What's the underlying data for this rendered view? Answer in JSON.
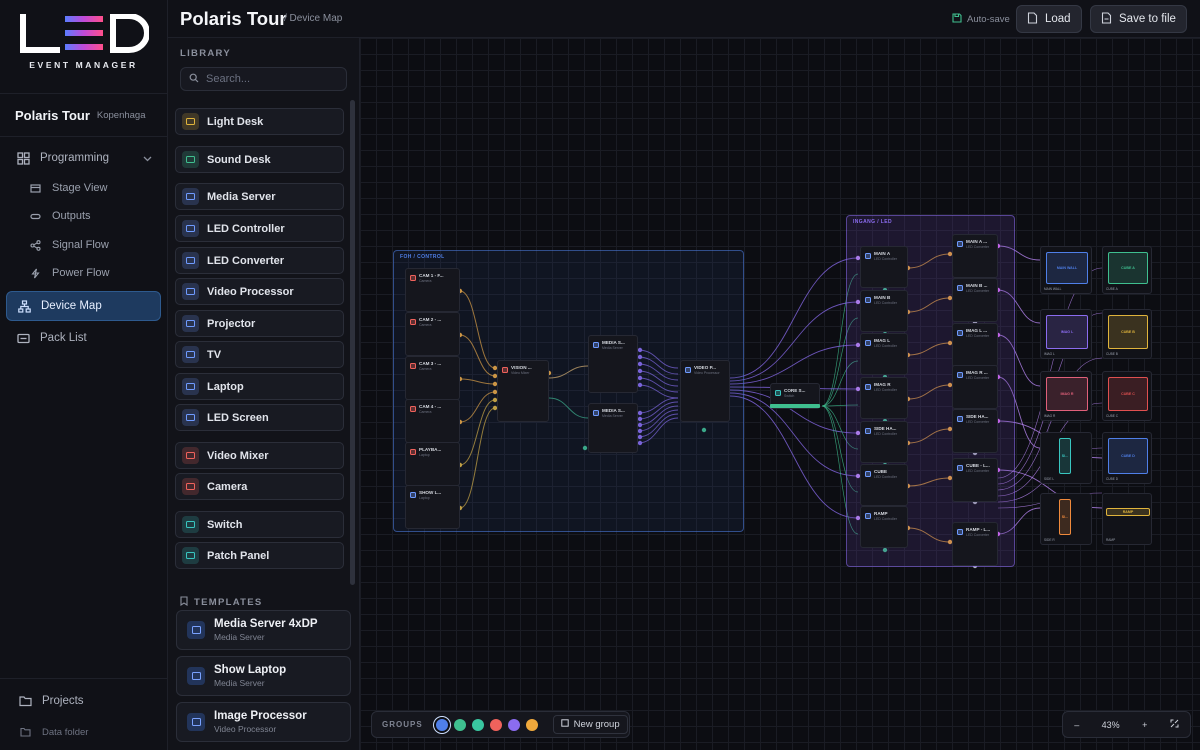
{
  "brand": {
    "logo_text": "LED",
    "subtitle": "EVENT MANAGER"
  },
  "project": {
    "name": "Polaris Tour",
    "location": "Kopenhaga"
  },
  "nav": {
    "programming": "Programming",
    "stage_view": "Stage View",
    "outputs": "Outputs",
    "signal_flow": "Signal Flow",
    "power_flow": "Power Flow",
    "device_map": "Device Map",
    "pack_list": "Pack List",
    "projects": "Projects",
    "data_folder": "Data folder"
  },
  "header": {
    "title": "Polaris Tour",
    "breadcrumb": "/ Device Map",
    "autosave": "Auto-save",
    "load": "Load",
    "save": "Save to file"
  },
  "library": {
    "label": "LIBRARY",
    "search_placeholder": "Search...",
    "items": [
      {
        "label": "Light Desk",
        "color": "#e0b43c"
      },
      {
        "label": "Sound Desk",
        "color": "#3fbf8f"
      },
      {
        "label": "Media Server",
        "color": "#6f9bff"
      },
      {
        "label": "LED Controller",
        "color": "#6f9bff"
      },
      {
        "label": "LED Converter",
        "color": "#6f9bff"
      },
      {
        "label": "Video Processor",
        "color": "#6f9bff"
      },
      {
        "label": "Projector",
        "color": "#6f9bff"
      },
      {
        "label": "TV",
        "color": "#6f9bff"
      },
      {
        "label": "Laptop",
        "color": "#6f9bff"
      },
      {
        "label": "LED Screen",
        "color": "#6f9bff"
      },
      {
        "label": "Video Mixer",
        "color": "#f0625c"
      },
      {
        "label": "Camera",
        "color": "#f0625c"
      },
      {
        "label": "Switch",
        "color": "#39c6c0"
      },
      {
        "label": "Patch Panel",
        "color": "#39c6c0"
      }
    ]
  },
  "templates": {
    "label": "TEMPLATES",
    "items": [
      {
        "name": "Media Server 4xDP",
        "type": "Media Server"
      },
      {
        "name": "Show Laptop",
        "type": "Media Server"
      },
      {
        "name": "Image Processor",
        "type": "Video Processor"
      }
    ]
  },
  "canvas": {
    "groups": [
      {
        "label": "FOH / CONTROL",
        "color": "#4f7fe8"
      },
      {
        "label": "INGANG / LED",
        "color": "#8b6cf0"
      }
    ],
    "foh_nodes": [
      {
        "title": "CAM 1 - F...",
        "sub": "Camera",
        "color": "#f0625c"
      },
      {
        "title": "CAM 2 - ...",
        "sub": "Camera",
        "color": "#f0625c"
      },
      {
        "title": "CAM 3 - ...",
        "sub": "Camera",
        "color": "#f0625c"
      },
      {
        "title": "CAM 4 - ...",
        "sub": "Camera",
        "color": "#f0625c"
      },
      {
        "title": "PLAYBA...",
        "sub": "Laptop",
        "color": "#f0625c"
      },
      {
        "title": "SHOW L...",
        "sub": "Laptop",
        "color": "#6f9bff"
      }
    ],
    "mixer_node": {
      "title": "VISION ...",
      "sub": "Video Mixer",
      "color": "#f0625c"
    },
    "media_nodes": [
      {
        "title": "MEDIA S...",
        "sub": "Media Server",
        "color": "#6f9bff"
      },
      {
        "title": "MEDIA S...",
        "sub": "Media Server",
        "color": "#6f9bff"
      }
    ],
    "processor_node": {
      "title": "VIDEO P...",
      "sub": "Video Processor",
      "color": "#6f9bff"
    },
    "switch_node": {
      "title": "CORE S...",
      "sub": "Switch",
      "color": "#39c6c0"
    },
    "controllers": [
      {
        "title": "MAIN A",
        "sub": "LED Controller"
      },
      {
        "title": "MAIN B",
        "sub": "LED Controller"
      },
      {
        "title": "IMAG L",
        "sub": "LED Controller"
      },
      {
        "title": "IMAG R",
        "sub": "LED Controller"
      },
      {
        "title": "SIDE HA...",
        "sub": "LED Controller"
      },
      {
        "title": "CUBE",
        "sub": "LED Controller"
      },
      {
        "title": "RAMP",
        "sub": "LED Controller"
      }
    ],
    "converters": [
      {
        "title": "MAIN A ...",
        "sub": "LED Converter"
      },
      {
        "title": "MAIN B ...",
        "sub": "LED Converter"
      },
      {
        "title": "IMAG L ...",
        "sub": "LED Converter"
      },
      {
        "title": "IMAG R ...",
        "sub": "LED Converter"
      },
      {
        "title": "SIDE HA...",
        "sub": "LED Converter"
      },
      {
        "title": "CUBE - L...",
        "sub": "LED Converter"
      },
      {
        "title": "RAMP - L...",
        "sub": "LED Converter"
      }
    ],
    "screens": [
      {
        "label": "MAIN WALL",
        "view": "MAIN WALL",
        "color": "#4f7fe8"
      },
      {
        "label": "CUBE A",
        "view": "CUBE A",
        "color": "#3fbf8f"
      },
      {
        "label": "IMAG L",
        "view": "IMAG L",
        "color": "#8b6cf0"
      },
      {
        "label": "CUBE B",
        "view": "CUBE B",
        "color": "#e0b43c"
      },
      {
        "label": "IMAG R",
        "view": "IMAG R",
        "color": "#e0607a"
      },
      {
        "label": "CUBE C",
        "view": "CUBE C",
        "color": "#e05050"
      },
      {
        "label": "SIDE L",
        "view": "SI...",
        "color": "#39c6c0"
      },
      {
        "label": "CUBE D",
        "view": "CUBE D",
        "color": "#4f7fe8"
      },
      {
        "label": "SIDE R",
        "view": "SI...",
        "color": "#f08a3c"
      },
      {
        "label": "RAMP",
        "view": "RAMP",
        "color": "#e0b43c"
      }
    ]
  },
  "groups_bar": {
    "label": "GROUPS",
    "colors": [
      "#4f7fe8",
      "#3fbf8f",
      "#39c6a0",
      "#f0625c",
      "#8b6cf0",
      "#f0a93c"
    ],
    "new_group": "New group"
  },
  "zoom": {
    "minus": "–",
    "value": "43%",
    "plus": "+"
  }
}
